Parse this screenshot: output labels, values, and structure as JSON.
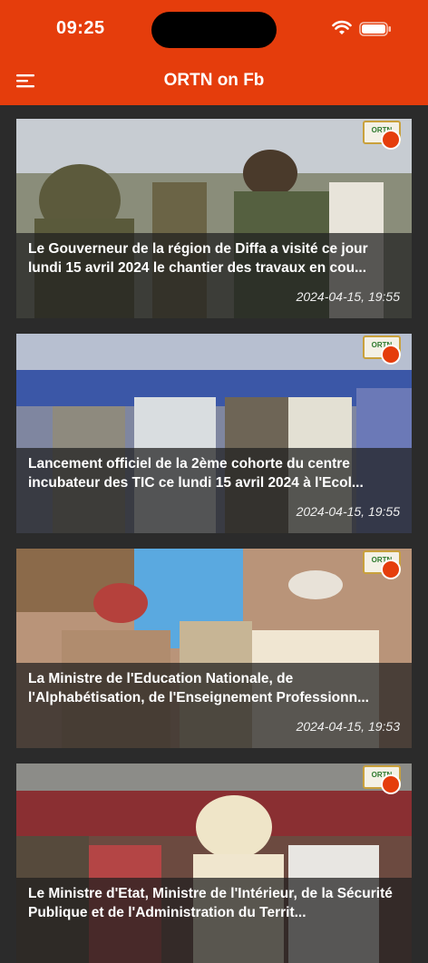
{
  "status_bar": {
    "time": "09:25"
  },
  "header": {
    "title": "ORTN on Fb"
  },
  "icons": {
    "menu": "hamburger-icon",
    "wifi": "wifi-icon",
    "battery": "battery-icon"
  },
  "colors": {
    "accent": "#e53d0c",
    "background": "#2b2b2b"
  },
  "posts": [
    {
      "title": "Le Gouverneur de la région de Diffa a visité ce jour lundi 15 avril 2024 le chantier des travaux en cou...",
      "date": "2024-04-15, 19:55",
      "logo": "ORTN"
    },
    {
      "title": "Lancement officiel de la 2ème cohorte du centre incubateur des TIC ce lundi 15 avril 2024 à l'Ecol...",
      "date": "2024-04-15, 19:55",
      "logo": "ORTN"
    },
    {
      "title": "La Ministre de l'Education Nationale, de l'Alphabétisation, de l'Enseignement Professionn...",
      "date": "2024-04-15, 19:53",
      "logo": "ORTN"
    },
    {
      "title": "Le Ministre d'Etat, Ministre de l'Intérieur, de la Sécurité Publique et de l'Administration du Territ...",
      "date": "",
      "logo": "ORTN"
    }
  ]
}
